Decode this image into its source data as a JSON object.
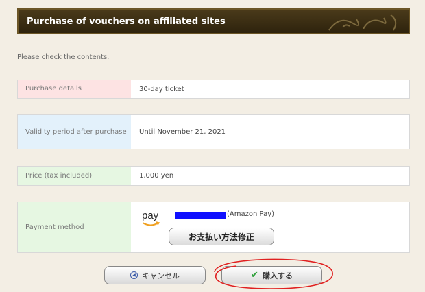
{
  "header": {
    "title": "Purchase of vouchers on affiliated sites"
  },
  "intro": "Please check the contents.",
  "details": {
    "purchase_label": "Purchase details",
    "purchase_value": "30-day ticket",
    "validity_label": "Validity period after purchase",
    "validity_value": "Until November 21, 2021",
    "price_label": "Price (tax included)",
    "price_value": "1,000 yen",
    "payment_label": "Payment method",
    "payment_logo_text": "pay",
    "payment_suffix": "(Amazon Pay)",
    "modify_button": "お支払い方法修正"
  },
  "actions": {
    "cancel_label": "キャンセル",
    "buy_label": "購入する"
  },
  "colors": {
    "header_bg": "#3a2d12",
    "purchase_label_bg": "#fde3e3",
    "validity_label_bg": "#e3f1fb",
    "price_label_bg": "#e6f7e2",
    "annotation_red": "#e02020",
    "redaction_blue": "#1010ff"
  },
  "icons": {
    "cancel": "circle-left-arrow-icon",
    "buy": "checkmark-icon",
    "payment": "amazon-pay-logo"
  }
}
